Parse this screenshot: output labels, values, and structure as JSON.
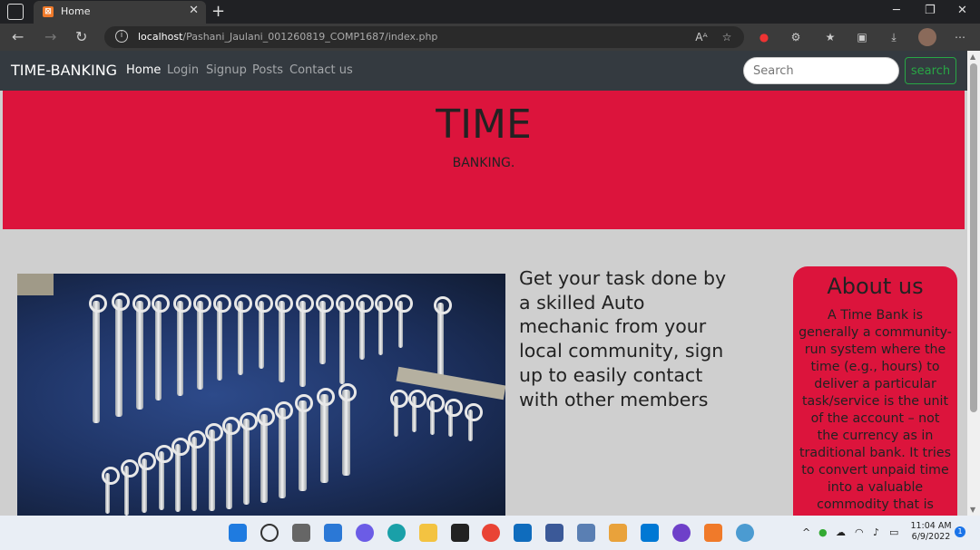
{
  "browser": {
    "tab_title": "Home",
    "tab_favicon": "xampp-icon",
    "new_tab_label": "+",
    "url_host": "localhost",
    "url_path": "/Pashani_Jaulani_001260819_COMP1687/index.php"
  },
  "nav": {
    "brand": "TIME-BANKING",
    "links": [
      "Home",
      "Login",
      "Signup",
      "Posts",
      "Contact us"
    ],
    "search_placeholder": "Search",
    "search_button": "search",
    "search_button_color": "#28a745"
  },
  "hero": {
    "title": "TIME",
    "subtitle": "BANKING.",
    "bg_color": "#dc143c"
  },
  "main": {
    "photo_description_icon": "wrench-wall-image",
    "task_text": "Get your task done by a skilled Auto mechanic from your local community, sign up to easily contact with other members"
  },
  "about": {
    "title": "About us",
    "text": "A Time Bank is generally a community-run system where the time (e.g., hours) to deliver a particular task/service is the unit of the account – not the currency as in traditional bank. It tries to convert unpaid time into a valuable commodity that is"
  },
  "taskbar": {
    "time": "11:04 AM",
    "date": "6/9/2022",
    "notification_count": "1"
  }
}
